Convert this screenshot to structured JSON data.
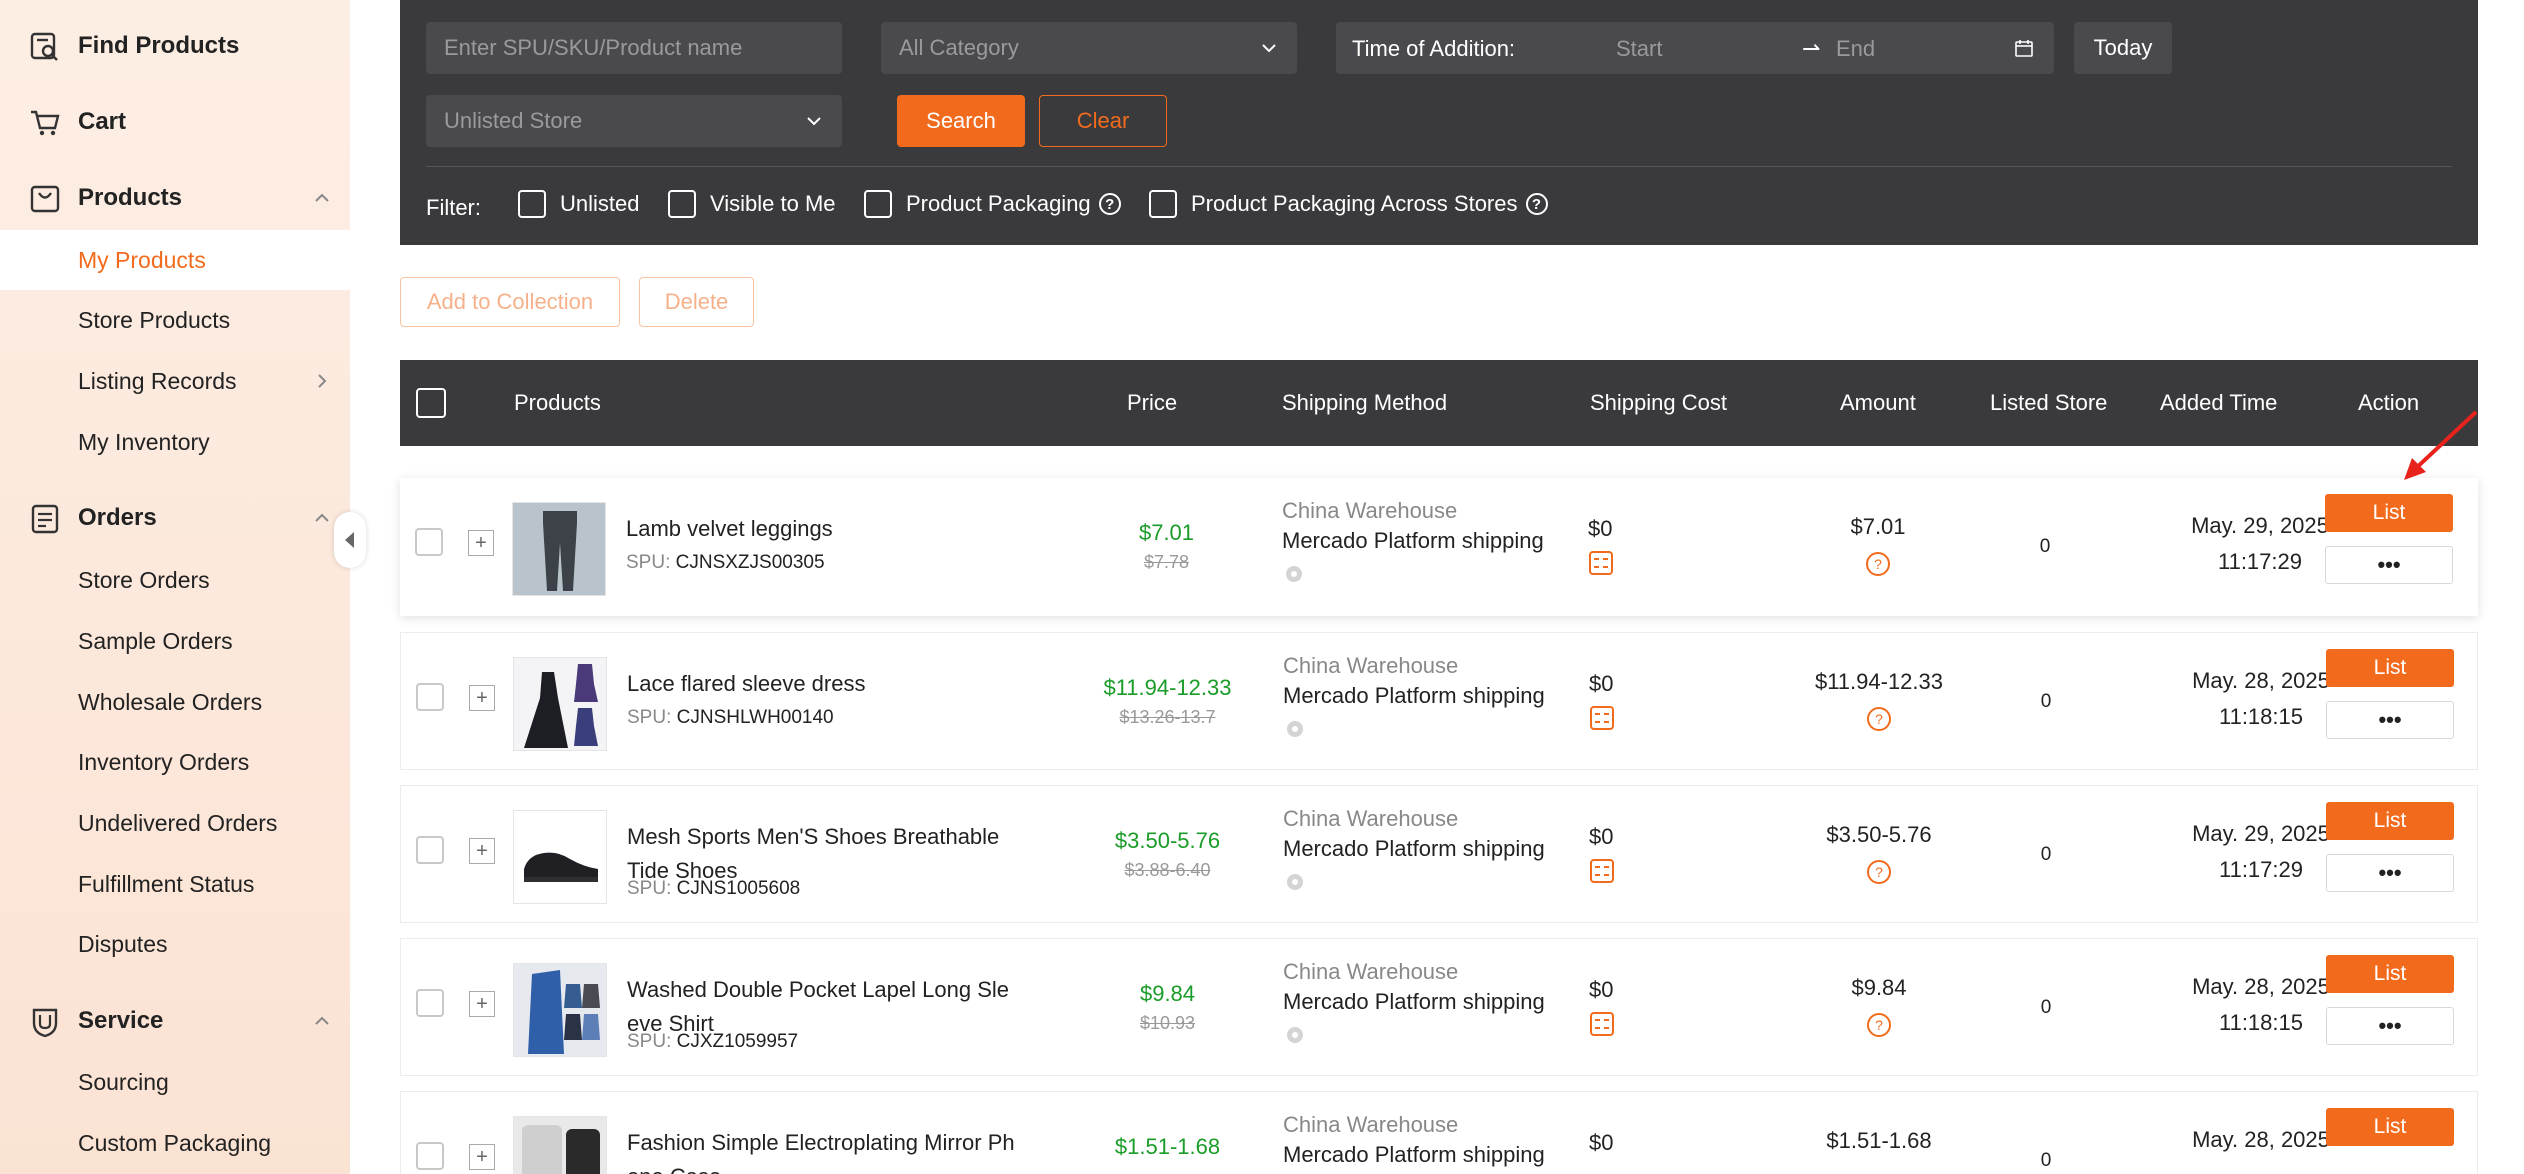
{
  "sidebar": {
    "find_products": "Find Products",
    "cart": "Cart",
    "products": "Products",
    "my_products": "My Products",
    "store_products": "Store Products",
    "listing_records": "Listing Records",
    "my_inventory": "My Inventory",
    "orders": "Orders",
    "store_orders": "Store Orders",
    "sample_orders": "Sample Orders",
    "wholesale_orders": "Wholesale Orders",
    "inventory_orders": "Inventory Orders",
    "undelivered_orders": "Undelivered Orders",
    "fulfillment_status": "Fulfillment Status",
    "disputes": "Disputes",
    "service": "Service",
    "sourcing": "Sourcing",
    "custom_packaging": "Custom Packaging"
  },
  "filters": {
    "search_placeholder": "Enter SPU/SKU/Product name",
    "category": "All Category",
    "time_label": "Time of Addition:",
    "time_start": "Start",
    "time_end": "End",
    "today": "Today",
    "store": "Unlisted Store",
    "search": "Search",
    "clear": "Clear",
    "filter_label": "Filter:",
    "unlisted": "Unlisted",
    "visible_to_me": "Visible to Me",
    "product_packaging": "Product Packaging",
    "packaging_across_stores": "Product Packaging Across Stores"
  },
  "actions": {
    "add_to_collection": "Add to Collection",
    "delete": "Delete"
  },
  "table": {
    "headers": {
      "products": "Products",
      "price": "Price",
      "shipping_method": "Shipping Method",
      "shipping_cost": "Shipping Cost",
      "amount": "Amount",
      "listed_store": "Listed Store",
      "added_time": "Added Time",
      "action": "Action"
    },
    "rows": [
      {
        "name": "Lamb velvet leggings",
        "spu_label": "SPU:",
        "spu": "CJNSXZJS00305",
        "price": "$7.01",
        "orig_price": "$7.78",
        "warehouse": "China Warehouse",
        "shipping": "Mercado Platform shipping",
        "cost": "$0",
        "amount": "$7.01",
        "listed": "0",
        "date": "May. 29, 2025",
        "time": "11:17:29",
        "list": "List",
        "more": "•••"
      },
      {
        "name": "Lace flared sleeve dress",
        "spu_label": "SPU:",
        "spu": "CJNSHLWH00140",
        "price": "$11.94-12.33",
        "orig_price": "$13.26-13.7",
        "warehouse": "China Warehouse",
        "shipping": "Mercado Platform shipping",
        "cost": "$0",
        "amount": "$11.94-12.33",
        "listed": "0",
        "date": "May. 28, 2025",
        "time": "11:18:15",
        "list": "List",
        "more": "•••"
      },
      {
        "name_line1": "Mesh Sports Men'S Shoes Breathable",
        "name_line2": "Tide Shoes",
        "spu_label": "SPU:",
        "spu": "CJNS1005608",
        "price": "$3.50-5.76",
        "orig_price": "$3.88-6.40",
        "warehouse": "China Warehouse",
        "shipping": "Mercado Platform shipping",
        "cost": "$0",
        "amount": "$3.50-5.76",
        "listed": "0",
        "date": "May. 29, 2025",
        "time": "11:17:29",
        "list": "List",
        "more": "•••"
      },
      {
        "name_line1": "Washed Double Pocket Lapel Long Sle",
        "name_line2": "eve Shirt",
        "spu_label": "SPU:",
        "spu": "CJXZ1059957",
        "price": "$9.84",
        "orig_price": "$10.93",
        "warehouse": "China Warehouse",
        "shipping": "Mercado Platform shipping",
        "cost": "$0",
        "amount": "$9.84",
        "listed": "0",
        "date": "May. 28, 2025",
        "time": "11:18:15",
        "list": "List",
        "more": "•••"
      },
      {
        "name_line1": "Fashion Simple Electroplating Mirror Ph",
        "name_line2": "one Case",
        "price": "$1.51-1.68",
        "warehouse": "China Warehouse",
        "shipping": "Mercado Platform shipping",
        "cost": "$0",
        "amount": "$1.51-1.68",
        "listed": "0",
        "date": "May. 28, 2025",
        "list": "List"
      }
    ]
  },
  "colors": {
    "accent": "#f26b1d",
    "price_green": "#1a9c28",
    "dark_panel": "#3a3a3d",
    "sidebar_bg": "#fdeee4"
  }
}
